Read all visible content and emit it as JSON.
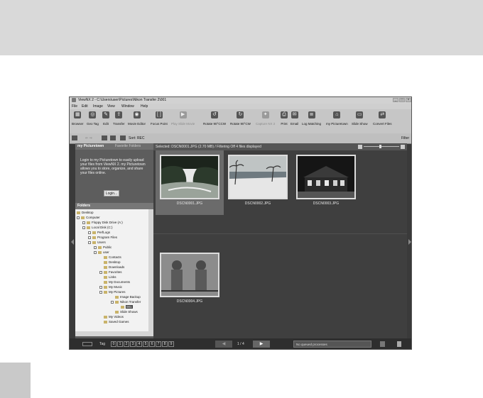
{
  "window": {
    "title": "ViewNX 2 - C:\\Users\\user\\Pictures\\Nikon Transfer 2\\001",
    "controls": [
      "_",
      "□",
      "×"
    ]
  },
  "menu": [
    "File",
    "Edit",
    "Image",
    "View",
    "Window",
    "Help"
  ],
  "toolbar": {
    "browser": "Browser",
    "geo_tag": "Geo Tag",
    "edit": "Edit",
    "transfer": "Transfer",
    "movie_editor": "Movie Editor",
    "focus_point": "Focus Point",
    "play_slide": "Play Slide Movie",
    "rotate_ccw": "Rotate 90°CCW",
    "rotate_cw": "Rotate 90°CW",
    "capture_nx2": "Capture NX 2",
    "print": "Print",
    "email": "Email",
    "log_matching": "Log Matching",
    "my_picturetown": "my Picturetown",
    "slide_show": "Slide Show",
    "convert_files": "Convert Files"
  },
  "subbar": {
    "sort": "Sort: REC",
    "filter": "Filter"
  },
  "left_tabs": {
    "active": "my Picturetown",
    "inactive": "Favorite Folders"
  },
  "picturetown": {
    "text": "Login to my Picturetown to easily upload your files from ViewNX 2. my Picturetown allows you to store, organize, and share your files online.",
    "login": "Login..."
  },
  "folders": {
    "header": "Folders",
    "tree": [
      {
        "label": "Desktop"
      },
      {
        "label": "Computer"
      },
      {
        "label": "Floppy Disk Drive (A:)"
      },
      {
        "label": "Local Disk (C:)"
      },
      {
        "label": "PerfLogs"
      },
      {
        "label": "Program Files"
      },
      {
        "label": "Users"
      },
      {
        "label": "Public"
      },
      {
        "label": "user"
      },
      {
        "label": "Contacts"
      },
      {
        "label": "Desktop"
      },
      {
        "label": "Downloads"
      },
      {
        "label": "Favorites"
      },
      {
        "label": "Links"
      },
      {
        "label": "My Documents"
      },
      {
        "label": "My Music"
      },
      {
        "label": "My Pictures"
      },
      {
        "label": "Image Backup"
      },
      {
        "label": "Nikon Transfer"
      },
      {
        "label": "001"
      },
      {
        "label": "Slide Shows"
      },
      {
        "label": "My Videos"
      },
      {
        "label": "Saved Games"
      }
    ]
  },
  "content": {
    "status": "Selected: DSCN0001.JPG (2.70 MB) / Filtering Off  4 files displayed",
    "thumbnails": [
      {
        "name": "DSCN0001.JPG"
      },
      {
        "name": "DSCN0002.JPG"
      },
      {
        "name": "DSCN0003.JPG"
      },
      {
        "name": "DSCN0004.JPG"
      }
    ]
  },
  "statusbar": {
    "tag": "Tag",
    "tags": [
      "0",
      "1",
      "2",
      "3",
      "4",
      "5",
      "6",
      "7",
      "8",
      "9"
    ],
    "page": "1 / 4",
    "prev": "◀",
    "next": "▶",
    "queue": "No queued processes"
  }
}
